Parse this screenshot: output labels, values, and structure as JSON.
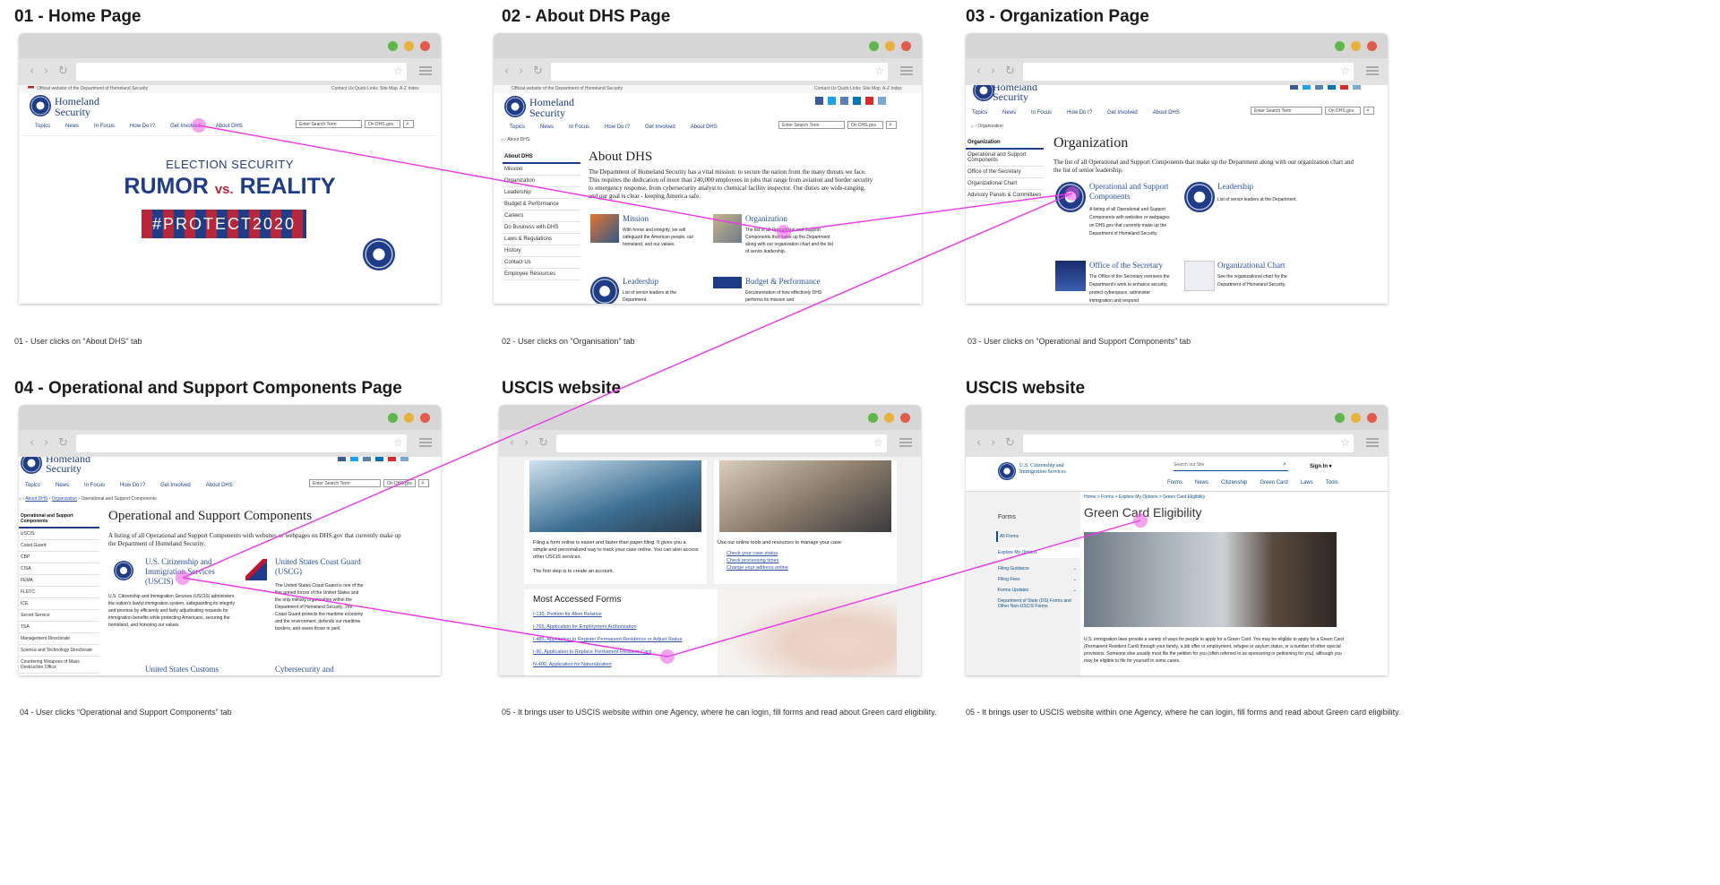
{
  "colors": {
    "dhs_blue": "#1f3c88",
    "link_blue": "#2c50a6",
    "flow_line": "#ee33ee",
    "banner_red": "#b8263a",
    "uscis_blue": "#0b4f8a"
  },
  "panel_titles": [
    "01 - Home Page",
    "02 - About DHS Page",
    "03 - Organization Page",
    "04 - Operational and Support Components Page",
    "USCIS website",
    "USCIS website"
  ],
  "captions": [
    "01 - User clicks on “About DHS” tab",
    "02 - User clicks on “Organisation” tab",
    "03 - User clicks on “Operational and Support Components” tab",
    "04 - User clicks “Operational and Support Components” tab",
    "05 - It brings user to USCIS website within one Agency, where he can login, fill forms and read about Green card eligibility.",
    "05 - It brings user to USCIS website within one Agency, where he can login, fill forms and read about Green card eligibility."
  ],
  "browser": {
    "nav_icons": [
      "back-arrow-icon",
      "forward-arrow-icon",
      "reload-icon"
    ],
    "star_icon": "star-icon",
    "menu_icon": "hamburger-menu-icon"
  },
  "dhs": {
    "official_text": "Official website of the Department of Homeland Security",
    "util_links": [
      "Contact Us",
      "Quick Links",
      "Site Map",
      "A-Z Index"
    ],
    "brand_line1": "Homeland",
    "brand_line2": "Security",
    "nav": [
      "Topics",
      "News",
      "In Focus",
      "How Do I?",
      "Get Involved",
      "About DHS"
    ],
    "search_placeholder": "Enter Search Term",
    "search_scope": "On DHS.gov",
    "search_icon": "magnifier-icon"
  },
  "home": {
    "banner_line1": "ELECTION SECURITY",
    "banner_rumor": "RUMOR",
    "banner_vs": "vs.",
    "banner_reality": "REALITY",
    "banner_tag": "#PROTECT2020",
    "pause_icon": "pause-icon"
  },
  "about": {
    "breadcrumb": "About DHS",
    "side_head": "About DHS",
    "side_items": [
      "Mission",
      "Organization",
      "Leadership",
      "Budget & Performance",
      "Careers",
      "Do Business with DHS",
      "Laws & Regulations",
      "History",
      "Contact Us",
      "Employee Resources"
    ],
    "title": "About DHS",
    "intro": "The Department of Homeland Security has a vital mission: to secure the nation from the many threats we face. This requires the dedication of more than 240,000 employees in jobs that range from aviation and border security to emergency response, from cybersecurity analyst to chemical facility inspector. Our duties are wide-ranging, and our goal is clear - keeping America safe.",
    "cards": [
      {
        "title": "Mission",
        "desc": "With honor and integrity, we will safeguard the American people, our homeland, and our values."
      },
      {
        "title": "Organization",
        "desc": "The list of all Operational and Support Components that make up the Department along with our organization chart and the list of senior leadership."
      },
      {
        "title": "Leadership",
        "desc": "List of senior leaders at the Department."
      },
      {
        "title": "Budget & Performance",
        "desc": "Documentation of how effectively DHS performs its mission and"
      }
    ]
  },
  "org": {
    "breadcrumb": "Organization",
    "side_head": "Organization",
    "side_items": [
      "Operational and Support Components",
      "Office of the Secretary",
      "Organizational Chart",
      "Advisory Panels & Committees"
    ],
    "title": "Organization",
    "intro": "The list of all Operational and Support Components that make up the Department along with our organization chart and the list of senior leadership.",
    "cards": [
      {
        "title": "Operational and Support Components",
        "desc": "A listing of all Operational and Support Components with websites or webpages on DHS.gov that currently make up the Department of Homeland Security."
      },
      {
        "title": "Leadership",
        "desc": "List of senior leaders at the Department."
      },
      {
        "title": "Office of the Secretary",
        "desc": "The Office of the Secretary oversees the Department's work to enhance security, protect cyberspace, administer immigration and respond"
      },
      {
        "title": "Organizational Chart",
        "desc": "See the organizational chart for the Department of Homeland Security."
      }
    ]
  },
  "ops": {
    "breadcrumb": [
      "About DHS",
      "Organization",
      "Operational and Support Components"
    ],
    "side_head": "Operational and Support Components",
    "side_items": [
      "USCIS",
      "Coast Guard",
      "CBP",
      "CISA",
      "FEMA",
      "FLETC",
      "ICE",
      "Secret Service",
      "TSA",
      "Management Directorate",
      "Science and Technology Directorate",
      "Countering Weapons of Mass Destruction Office"
    ],
    "title": "Operational and Support Components",
    "intro": "A listing of all Operational and Support Components with websites or webpages on DHS.gov that currently make up the Department of Homeland Security.",
    "uscis_title": "U.S. Citizenship and Immigration Services (USCIS)",
    "uscis_desc": "U.S. Citizenship and Immigration Services (USCIS) administers the nation's lawful immigration system, safeguarding its integrity and promise by efficiently and fairly adjudicating requests for immigration benefits while protecting Americans, securing the homeland, and honoring our values.",
    "uscg_title": "United States Coast Guard (USCG)",
    "uscg_desc": "The United States Coast Guard is one of the five armed forces of the United States and the only military organization within the Department of Homeland Security. The Coast Guard protects the maritime economy and the environment, defends our maritime borders, and saves those in peril.",
    "more1": "United States Customs",
    "more2": "Cybersecurity and"
  },
  "uscis1": {
    "filing_text": "Filing a form online is easier and faster than paper filing. It gives you a simple and personalized way to track your case online. You can also access other USCIS services.",
    "first_step": "The first step is to create an account.",
    "tools_text": "Use our online tools and resources to manage your case:",
    "tools_links": [
      "Check your case status",
      "Check processing times",
      "Change your address online"
    ],
    "forms_title": "Most Accessed Forms",
    "forms": [
      "I-130, Petition for Alien Relative",
      "I-765, Application for Employment Authorization",
      "I-485, Application to Register Permanent Residence or Adjust Status",
      "I-90, Application to Replace Permanent Resident Card",
      "N-400, Application for Naturalization"
    ]
  },
  "uscis2": {
    "brand": "U.S. Citizenship and Immigration Services",
    "search_placeholder": "Search our Site",
    "sign_in": "Sign In ▾",
    "nav": [
      "Forms",
      "News",
      "Citizenship",
      "Green Card",
      "Laws",
      "Tools"
    ],
    "breadcrumb": "Home > Forms > Explore My Options > Green Card Eligibility",
    "side_head": "Forms",
    "side_items": [
      "All Forms",
      "Explore My Options",
      "Filing Guidance",
      "Filing Fees",
      "Forms Updates",
      "Department of State (DS) Forms and Other Non-USCIS Forms"
    ],
    "title": "Green Card Eligibility",
    "body": "U.S. immigration laws provide a variety of ways for people to apply for a Green Card. You may be eligible to apply for a Green Card (Permanent Resident Card) through your family, a job offer or employment, refugee or asylum status, or a number of other special provisions. Someone else usually must file the petition for you (often referred to as sponsoring or petitioning for you), although you may be eligible to file for yourself in some cases."
  }
}
